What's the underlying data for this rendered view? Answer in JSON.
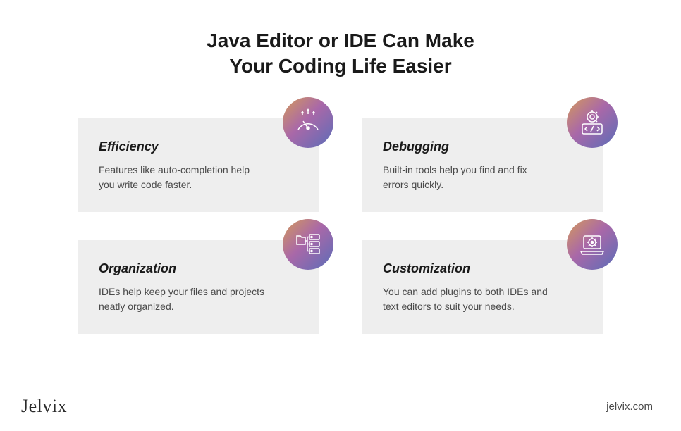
{
  "title_line1": "Java Editor or IDE Can Make",
  "title_line2": "Your Coding Life Easier",
  "cards": [
    {
      "title": "Efficiency",
      "description": "Features like auto-completion help you write code faster.",
      "icon": "gauge-icon"
    },
    {
      "title": "Debugging",
      "description": "Built-in tools help you find and fix errors quickly.",
      "icon": "debug-icon"
    },
    {
      "title": "Organization",
      "description": "IDEs help keep your files and projects neatly organized.",
      "icon": "folder-tree-icon"
    },
    {
      "title": "Customization",
      "description": "You can add plugins to both IDEs and text editors to suit your needs.",
      "icon": "laptop-gear-icon"
    }
  ],
  "footer": {
    "logo": "Jelvix",
    "website": "jelvix.com"
  }
}
